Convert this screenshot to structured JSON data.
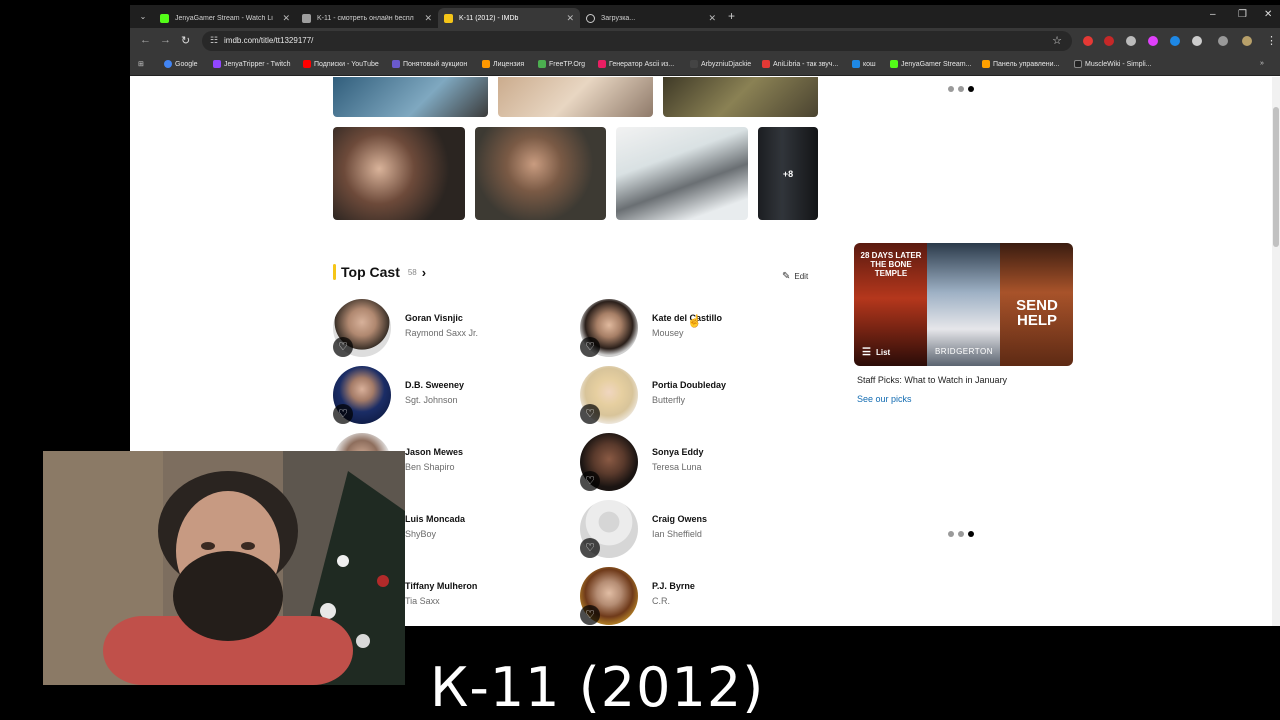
{
  "browser": {
    "tabs": [
      {
        "title": "JenyaGamer Stream - Watch Li",
        "color": "#53fc18",
        "active": false
      },
      {
        "title": "K-11 - смотреть онлайн беспл",
        "color": "#9e9e9e",
        "active": false
      },
      {
        "title": "K-11 (2012) - IMDb",
        "color": "#f5c518",
        "active": true
      },
      {
        "title": "Загрузка...",
        "color": "#cccccc",
        "active": false
      }
    ],
    "new_tab_glyph": "+",
    "url": "imdb.com/title/tt1329177/",
    "bookmarks": [
      {
        "label": "Google",
        "color": "#4285f4"
      },
      {
        "label": "JenyaTripper - Twitch",
        "color": "#9146ff"
      },
      {
        "label": "Подписки - YouTube",
        "color": "#ff0000"
      },
      {
        "label": "Понятовый аукцион",
        "color": "#6a5acd"
      },
      {
        "label": "Лицензия",
        "color": "#ff9800"
      },
      {
        "label": "FreeTP.Org",
        "color": "#4caf50"
      },
      {
        "label": "Генератор Ascii из...",
        "color": "#e91e63"
      },
      {
        "label": "ArbyzniuDjackie",
        "color": "#333333"
      },
      {
        "label": "AniLibria - так звуч...",
        "color": "#e53935"
      },
      {
        "label": "кош",
        "color": "#1e88e5"
      },
      {
        "label": "JenyaGamer Stream...",
        "color": "#53fc18"
      },
      {
        "label": "Панель управлени...",
        "color": "#ffa000"
      },
      {
        "label": "MuscleWiki - Simpli...",
        "color": "#222222"
      }
    ]
  },
  "page": {
    "photos_more": "+8",
    "top_cast": {
      "title": "Top Cast",
      "count": "58",
      "edit_label": "Edit"
    },
    "cast": [
      {
        "name": "Goran Visnjic",
        "role": "Raymond Saxx Jr."
      },
      {
        "name": "Kate del Castillo",
        "role": "Mousey"
      },
      {
        "name": "D.B. Sweeney",
        "role": "Sgt. Johnson"
      },
      {
        "name": "Portia Doubleday",
        "role": "Butterfly"
      },
      {
        "name": "Jason Mewes",
        "role": "Ben Shapiro"
      },
      {
        "name": "Sonya Eddy",
        "role": "Teresa Luna"
      },
      {
        "name": "Luis Moncada",
        "role": "ShyBoy"
      },
      {
        "name": "Craig Owens",
        "role": "Ian Sheffield"
      },
      {
        "name": "Tiffany Mulheron",
        "role": "Tia Saxx"
      },
      {
        "name": "P.J. Byrne",
        "role": "C.R."
      }
    ],
    "promo": {
      "posters": [
        "28 DAYS LATER THE BONE TEMPLE",
        "BRIDGERTON",
        "SEND HELP"
      ],
      "list_label": "List",
      "caption": "Staff Picks: What to Watch in January",
      "link": "See our picks"
    }
  },
  "overlay": {
    "video_title": "К-11 (2012)"
  }
}
